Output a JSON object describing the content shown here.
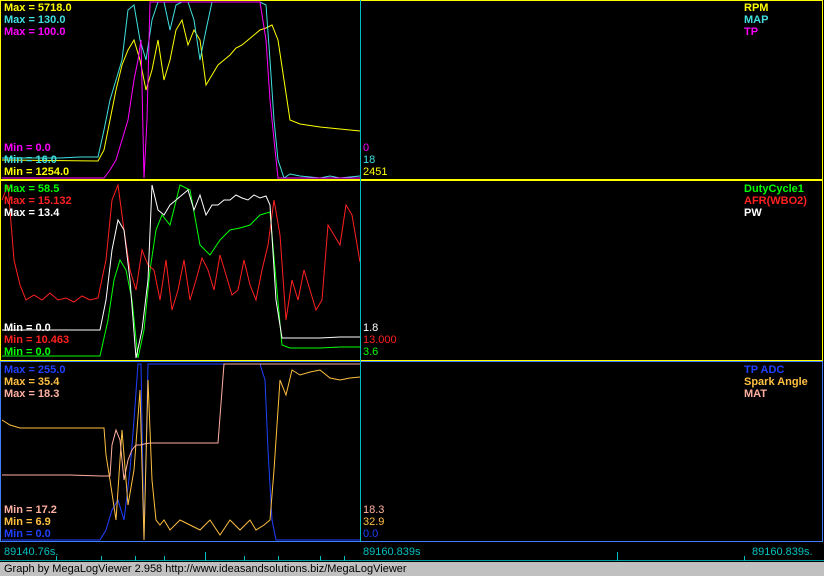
{
  "colors": {
    "background": "#000000",
    "border_top": "#ffff00",
    "border_other": "#4080ff",
    "cursor": "#00c0c0"
  },
  "panels": [
    {
      "series": [
        {
          "name": "RPM",
          "color": "#ffff00",
          "max": "Max = 5718.0",
          "min": "Min = 1254.0",
          "cursor": "2451"
        },
        {
          "name": "MAP",
          "color": "#40e0e0",
          "max": "Max = 130.0",
          "min": "Min = 16.0",
          "cursor": "18"
        },
        {
          "name": "TP",
          "color": "#ff00ff",
          "max": "Max = 100.0",
          "min": "Min = 0.0",
          "cursor": "0"
        }
      ]
    },
    {
      "series": [
        {
          "name": "DutyCycle1",
          "color": "#00ff00",
          "max": "Max = 58.5",
          "min": "Min = 0.0",
          "cursor": "3.6"
        },
        {
          "name": "AFR(WBO2)",
          "color": "#ff2020",
          "max": "Max = 15.132",
          "min": "Min = 10.463",
          "cursor": "13.000"
        },
        {
          "name": "PW",
          "color": "#ffffff",
          "max": "Max = 13.4",
          "min": "Min = 0.0",
          "cursor": "1.8"
        }
      ]
    },
    {
      "series": [
        {
          "name": "TP ADC",
          "color": "#2040ff",
          "max": "Max = 255.0",
          "min": "Min = 0.0",
          "cursor": "0.0"
        },
        {
          "name": "Spark Angle",
          "color": "#ffc040",
          "max": "Max = 35.4",
          "min": "Min = 6.9",
          "cursor": "32.9"
        },
        {
          "name": "MAT",
          "color": "#ffb0a0",
          "max": "Max = 18.3",
          "min": "Min = 17.2",
          "cursor": "18.3"
        }
      ]
    }
  ],
  "timeline": {
    "start": "89140.76s.",
    "cursor": "89160.839s",
    "end": "89160.839s."
  },
  "footer": "Graph by MegaLogViewer 2.958 http://www.ideasandsolutions.biz/MegaLogViewer"
}
